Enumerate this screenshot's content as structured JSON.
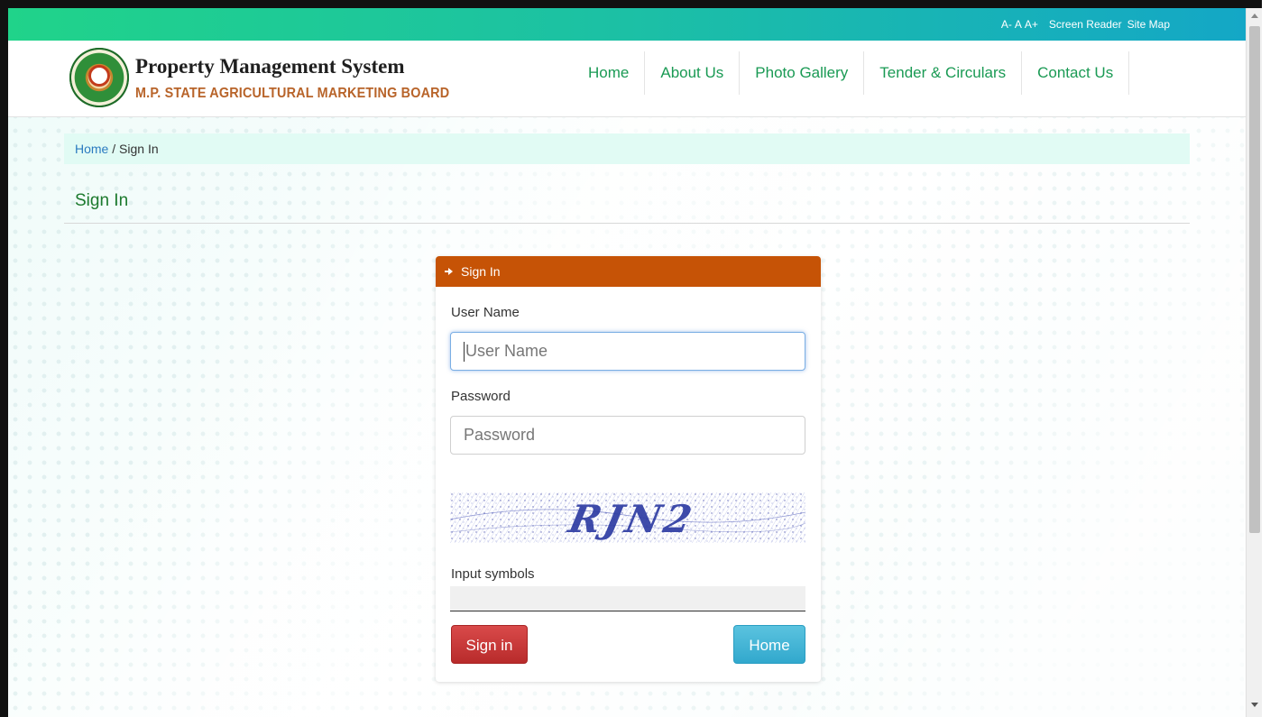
{
  "topbar": {
    "font_small": "A-",
    "font_normal": "A",
    "font_large": "A+",
    "screen_reader": "Screen Reader",
    "site_map": "Site Map"
  },
  "brand": {
    "title": "Property Management System",
    "subtitle": "M.P. STATE AGRICULTURAL MARKETING BOARD"
  },
  "nav": {
    "items": [
      "Home",
      "About Us",
      "Photo Gallery",
      "Tender & Circulars",
      "Contact Us"
    ]
  },
  "breadcrumb": {
    "home": "Home",
    "separator": " / ",
    "current": "Sign In"
  },
  "page": {
    "title": "Sign In"
  },
  "signin_panel": {
    "heading": "Sign In",
    "username_label": "User Name",
    "username_placeholder": "User Name",
    "password_label": "Password",
    "password_placeholder": "Password",
    "captcha_text": "RJN2",
    "symbols_label": "Input symbols",
    "signin_button": "Sign in",
    "home_button": "Home"
  },
  "colors": {
    "accent_green": "#1a9a54",
    "panel_header": "#c65306",
    "signin_button": "#c93737",
    "home_button": "#45b6d8"
  }
}
